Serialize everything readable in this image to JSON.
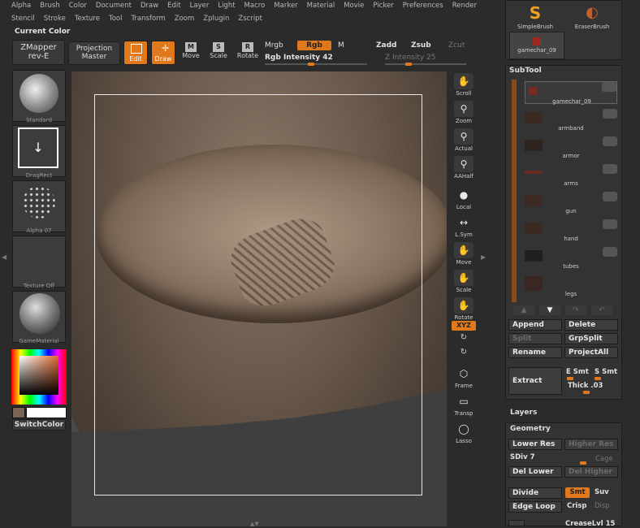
{
  "menu": {
    "row1": [
      "Alpha",
      "Brush",
      "Color",
      "Document",
      "Draw",
      "Edit",
      "Layer",
      "Light",
      "Macro",
      "Marker",
      "Material",
      "Movie",
      "Picker",
      "Preferences",
      "Render"
    ],
    "row2": [
      "Stencil",
      "Stroke",
      "Texture",
      "Tool",
      "Transform",
      "Zoom",
      "Zplugin",
      "Zscript"
    ]
  },
  "current_color_label": "Current Color",
  "zmapper": {
    "line1": "ZMapper",
    "line2": "rev-E"
  },
  "projection": {
    "line1": "Projection",
    "line2": "Master"
  },
  "modes": {
    "edit": "Edit",
    "draw": "Draw",
    "move": "Move",
    "scale": "Scale",
    "rotate": "Rotate"
  },
  "rgb": {
    "mrgb": "Mrgb",
    "rgb": "Rgb",
    "m": "M",
    "intensity": "Rgb Intensity 42",
    "intensity_value": 42
  },
  "z": {
    "zadd": "Zadd",
    "zsub": "Zsub",
    "zcut": "Zcut",
    "intensity": "Z Intensity 25",
    "intensity_value": 25
  },
  "left_thumbs": [
    {
      "name": "brush-thumb",
      "label": "Standard"
    },
    {
      "name": "stroke-thumb",
      "label": "DragRect"
    },
    {
      "name": "alpha-thumb",
      "label": "Alpha 07"
    },
    {
      "name": "texture-thumb",
      "label": "Texture Off"
    },
    {
      "name": "material-thumb",
      "label": "GameMaterial"
    }
  ],
  "switch_color": "SwitchColor",
  "right_tools": [
    "Scroll",
    "Zoom",
    "Actual",
    "AAHalf",
    "Local",
    "L.Sym",
    "Move",
    "Scale",
    "Rotate",
    "XYZ",
    "",
    "",
    "Frame",
    "Transp",
    "Lasso"
  ],
  "brushes": {
    "b1": "SimpleBrush",
    "b2": "EraserBrush",
    "b3": "gamechar_09"
  },
  "subtool": {
    "title": "SubTool",
    "items": [
      "gamechar_09",
      "armband",
      "armor",
      "arms",
      "gun",
      "hand",
      "tubes",
      "legs"
    ]
  },
  "subtool_buttons": {
    "append": "Append",
    "delete": "Delete",
    "split": "Split",
    "grpsplit": "GrpSplit",
    "rename": "Rename",
    "projectall": "ProjectAll",
    "extract": "Extract",
    "e_smt": "E Smt",
    "s_smt": "S Smt",
    "thick": "Thick .03"
  },
  "layers_label": "Layers",
  "geometry": {
    "title": "Geometry",
    "lower_res": "Lower Res",
    "higher_res": "Higher Res",
    "sdiv": "SDiv 7",
    "cage": "Cage",
    "del_lower": "Del Lower",
    "del_higher": "Del Higher",
    "divide": "Divide",
    "smt": "Smt",
    "suv": "Suv",
    "edge_loop": "Edge Loop",
    "crisp": "Crisp",
    "disp": "Disp",
    "crease": "CreaseLvl 15"
  },
  "colors": {
    "accent": "#e0781c",
    "bg": "#2b2b2b",
    "panel": "#333333"
  }
}
